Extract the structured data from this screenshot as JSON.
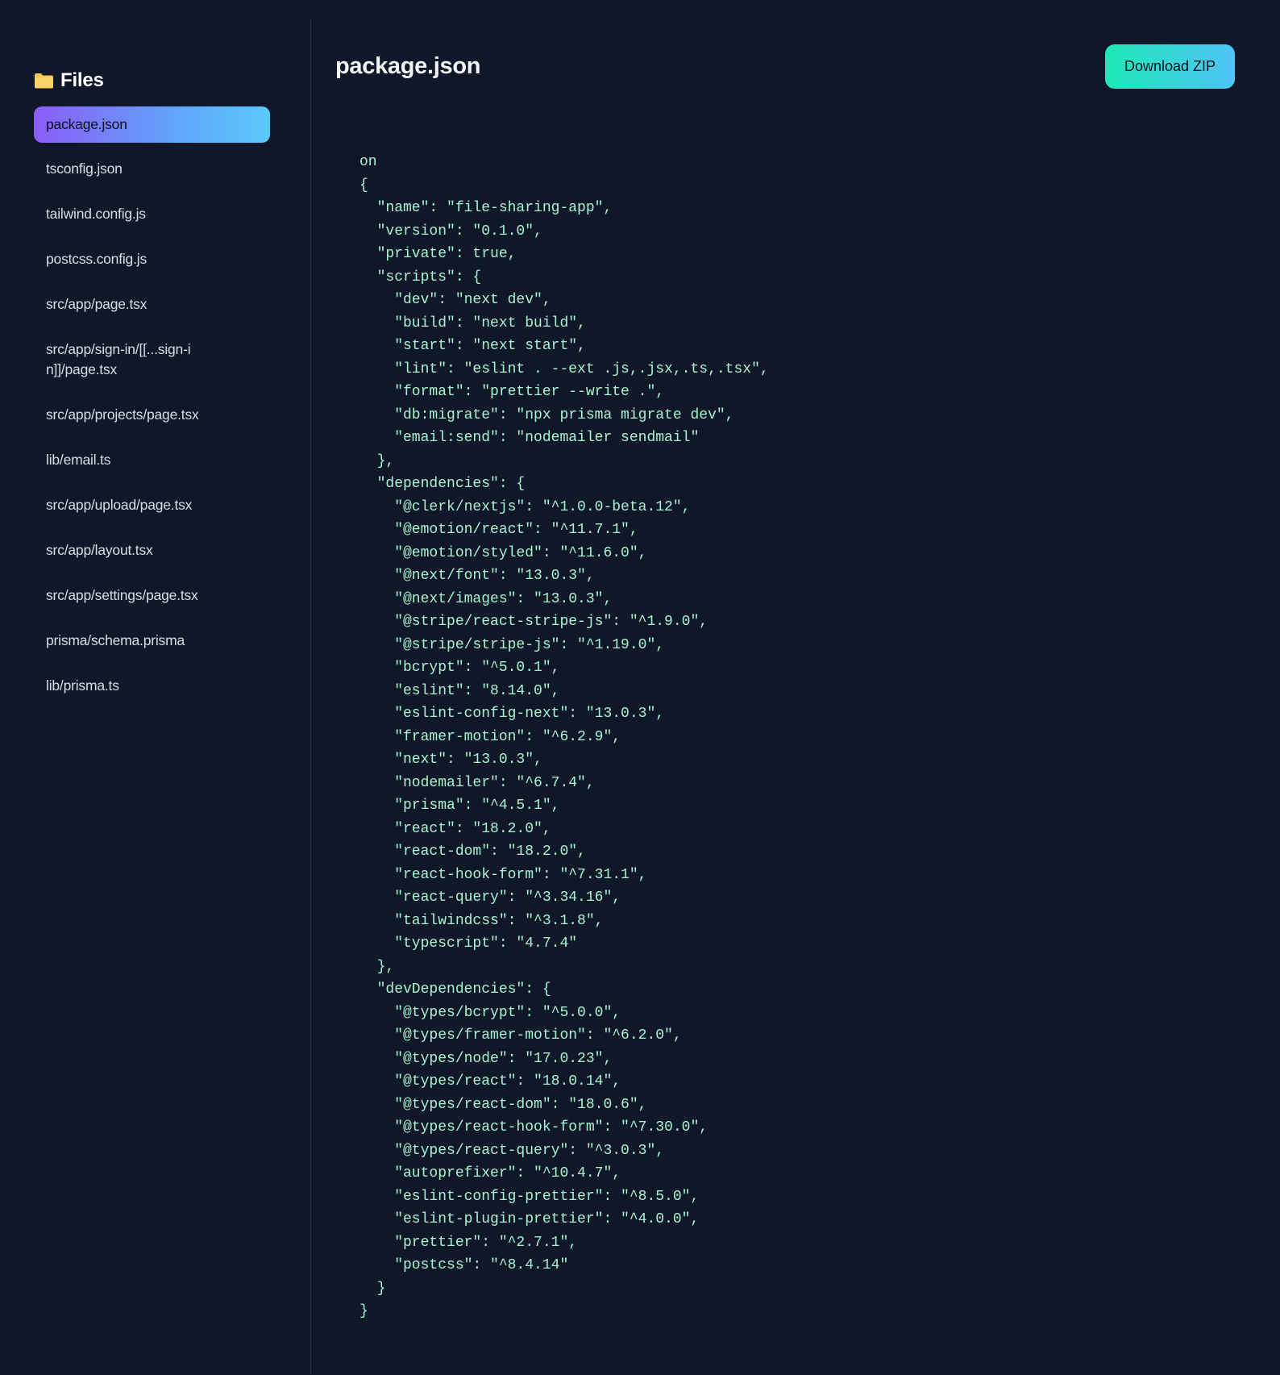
{
  "sidebar": {
    "title": "Files",
    "folder_icon": "folder-icon",
    "folder_color": "#f9c74f",
    "files": [
      {
        "label": "package.json",
        "active": true
      },
      {
        "label": "tsconfig.json"
      },
      {
        "label": "tailwind.config.js"
      },
      {
        "label": "postcss.config.js"
      },
      {
        "label": "src/app/page.tsx"
      },
      {
        "label": "src/app/sign-in/[[...sign-in]]/page.tsx"
      },
      {
        "label": "src/app/projects/page.tsx"
      },
      {
        "label": "lib/email.ts"
      },
      {
        "label": "src/app/upload/page.tsx"
      },
      {
        "label": "src/app/layout.tsx"
      },
      {
        "label": "src/app/settings/page.tsx"
      },
      {
        "label": "prisma/schema.prisma"
      },
      {
        "label": "lib/prisma.ts"
      }
    ]
  },
  "main": {
    "title": "package.json",
    "download_label": "Download ZIP",
    "code": "on\n{\n  \"name\": \"file-sharing-app\",\n  \"version\": \"0.1.0\",\n  \"private\": true,\n  \"scripts\": {\n    \"dev\": \"next dev\",\n    \"build\": \"next build\",\n    \"start\": \"next start\",\n    \"lint\": \"eslint . --ext .js,.jsx,.ts,.tsx\",\n    \"format\": \"prettier --write .\",\n    \"db:migrate\": \"npx prisma migrate dev\",\n    \"email:send\": \"nodemailer sendmail\"\n  },\n  \"dependencies\": {\n    \"@clerk/nextjs\": \"^1.0.0-beta.12\",\n    \"@emotion/react\": \"^11.7.1\",\n    \"@emotion/styled\": \"^11.6.0\",\n    \"@next/font\": \"13.0.3\",\n    \"@next/images\": \"13.0.3\",\n    \"@stripe/react-stripe-js\": \"^1.9.0\",\n    \"@stripe/stripe-js\": \"^1.19.0\",\n    \"bcrypt\": \"^5.0.1\",\n    \"eslint\": \"8.14.0\",\n    \"eslint-config-next\": \"13.0.3\",\n    \"framer-motion\": \"^6.2.9\",\n    \"next\": \"13.0.3\",\n    \"nodemailer\": \"^6.7.4\",\n    \"prisma\": \"^4.5.1\",\n    \"react\": \"18.2.0\",\n    \"react-dom\": \"18.2.0\",\n    \"react-hook-form\": \"^7.31.1\",\n    \"react-query\": \"^3.34.16\",\n    \"tailwindcss\": \"^3.1.8\",\n    \"typescript\": \"4.7.4\"\n  },\n  \"devDependencies\": {\n    \"@types/bcrypt\": \"^5.0.0\",\n    \"@types/framer-motion\": \"^6.2.0\",\n    \"@types/node\": \"17.0.23\",\n    \"@types/react\": \"18.0.14\",\n    \"@types/react-dom\": \"18.0.6\",\n    \"@types/react-hook-form\": \"^7.30.0\",\n    \"@types/react-query\": \"^3.0.3\",\n    \"autoprefixer\": \"^10.4.7\",\n    \"eslint-config-prettier\": \"^8.5.0\",\n    \"eslint-plugin-prettier\": \"^4.0.0\",\n    \"prettier\": \"^2.7.1\",\n    \"postcss\": \"^8.4.14\"\n  }\n}"
  },
  "colors": {
    "background": "#0f1729",
    "code_text": "#a7f3d0",
    "active_gradient_start": "#8b5cf6",
    "active_gradient_end": "#5ac8fa",
    "button_gradient_start": "#1de9b6",
    "button_gradient_end": "#4fc3f7"
  }
}
